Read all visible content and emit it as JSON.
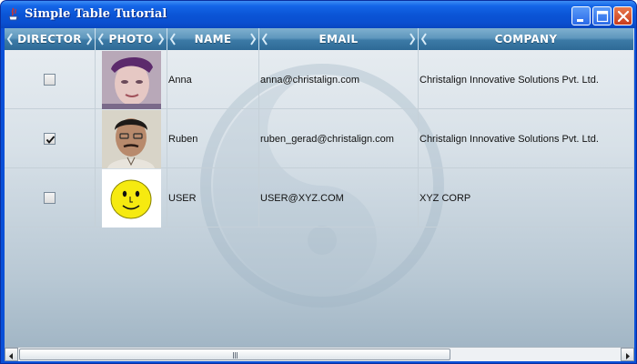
{
  "window": {
    "title": "Simple Table Tutorial",
    "controls": [
      "minimize",
      "maximize",
      "close"
    ]
  },
  "table": {
    "columns": [
      "DIRECTOR",
      "PHOTO",
      "NAME",
      "EMAIL",
      "COMPANY"
    ],
    "rows": [
      {
        "director": false,
        "photo": "portrait-woman",
        "name": "Anna",
        "email": "anna@christalign.com",
        "company": "Christalign Innovative Solutions Pvt. Ltd."
      },
      {
        "director": true,
        "photo": "portrait-man",
        "name": "Ruben",
        "email": "ruben_gerad@christalign.com",
        "company": "Christalign Innovative Solutions Pvt. Ltd."
      },
      {
        "director": false,
        "photo": "smiley-face",
        "name": "USER",
        "email": "USER@XYZ.COM",
        "company": "XYZ CORP"
      }
    ]
  },
  "colors": {
    "title_bar": "#0a50d8",
    "header": "#4a86b2",
    "close_button": "#d2512a"
  },
  "scrollbar": {
    "orientation": "horizontal",
    "visible_fraction": 0.69,
    "position": 0.0
  }
}
